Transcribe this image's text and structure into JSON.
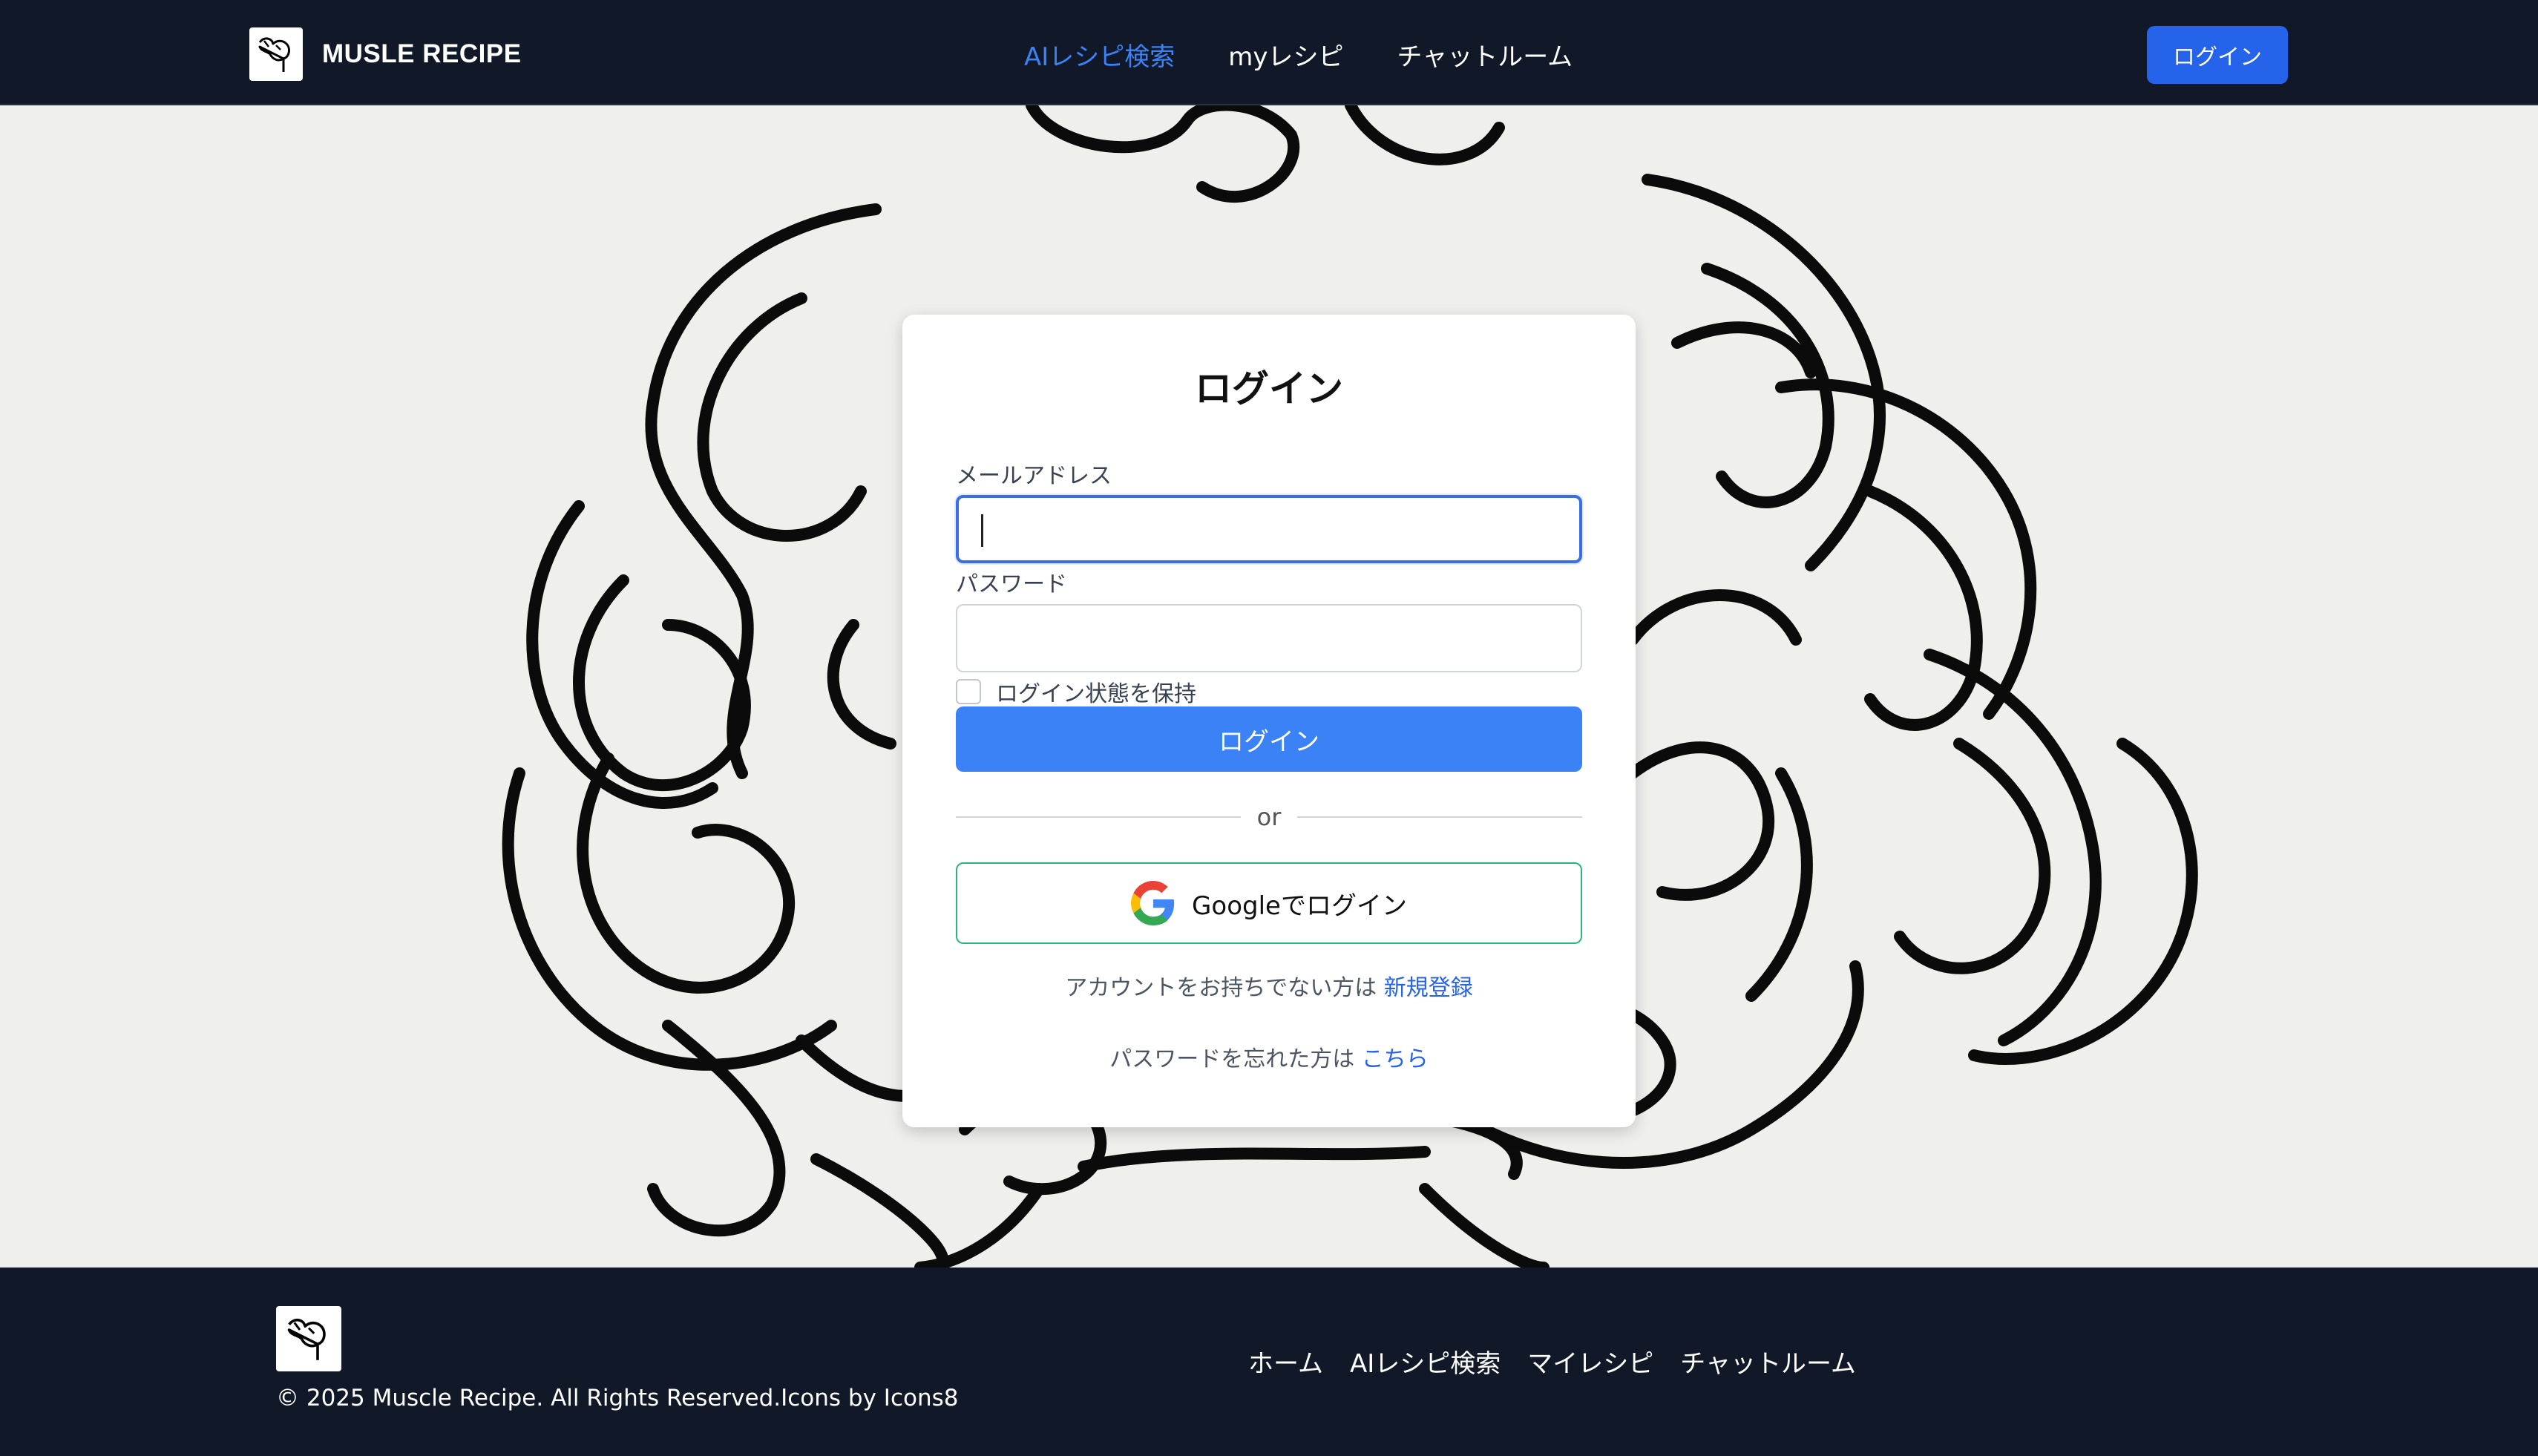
{
  "header": {
    "brand": "MUSLE RECIPE",
    "nav": [
      "AIレシピ検索",
      "myレシピ",
      "チャットルーム"
    ],
    "login_button": "ログイン"
  },
  "login_card": {
    "title": "ログイン",
    "email_label": "メールアドレス",
    "email_value": "",
    "password_label": "パスワード",
    "password_value": "",
    "remember_label": "ログイン状態を保持",
    "remember_checked": false,
    "submit_label": "ログイン",
    "divider_text": "or",
    "google_label": "Googleでログイン",
    "signup_prompt": "アカウントをお持ちでない方は",
    "signup_link": "新規登録",
    "forgot_prompt": "パスワードを忘れた方は",
    "forgot_link": "こちら"
  },
  "footer": {
    "nav": [
      "ホーム",
      "AIレシピ検索",
      "マイレシピ",
      "チャットルーム"
    ],
    "copyright": "© 2025 Muscle Recipe. All Rights Reserved.Icons by Icons8"
  },
  "colors": {
    "header_bg": "#111827",
    "accent": "#3b82f6",
    "primary_button": "#2563eb",
    "google_border": "#2bb57a"
  },
  "icons": {
    "brand_logo": "flexing-arm-icon",
    "google": "google-g-icon"
  }
}
